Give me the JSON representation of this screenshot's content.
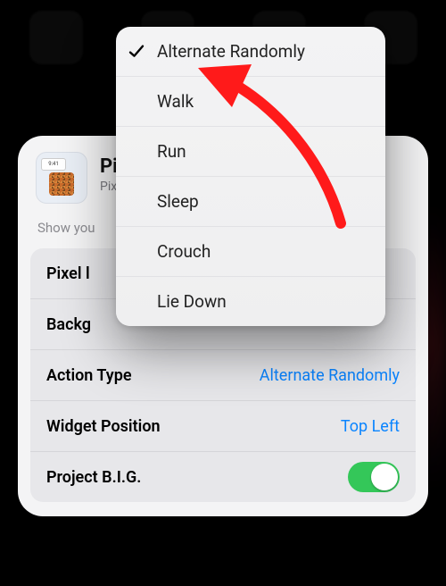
{
  "app": {
    "title": "Pix",
    "subtitle": "Pixe",
    "iconTime": "9:41"
  },
  "desc": "Show you",
  "settings": {
    "rows": [
      {
        "label": "Pixel l",
        "value": ""
      },
      {
        "label": "Backg",
        "value": ""
      },
      {
        "label": "Action Type",
        "value": "Alternate Randomly"
      },
      {
        "label": "Widget Position",
        "value": "Top Left"
      },
      {
        "label": "Project B.I.G.",
        "value": "",
        "toggle": true,
        "toggleOn": true
      }
    ]
  },
  "menu": {
    "items": [
      {
        "label": "Alternate Randomly",
        "checked": true
      },
      {
        "label": "Walk",
        "checked": false
      },
      {
        "label": "Run",
        "checked": false
      },
      {
        "label": "Sleep",
        "checked": false
      },
      {
        "label": "Crouch",
        "checked": false
      },
      {
        "label": "Lie Down",
        "checked": false
      }
    ]
  },
  "colors": {
    "link": "#0a84ff",
    "toggleOn": "#34c759",
    "arrow": "#ff1a1a"
  }
}
